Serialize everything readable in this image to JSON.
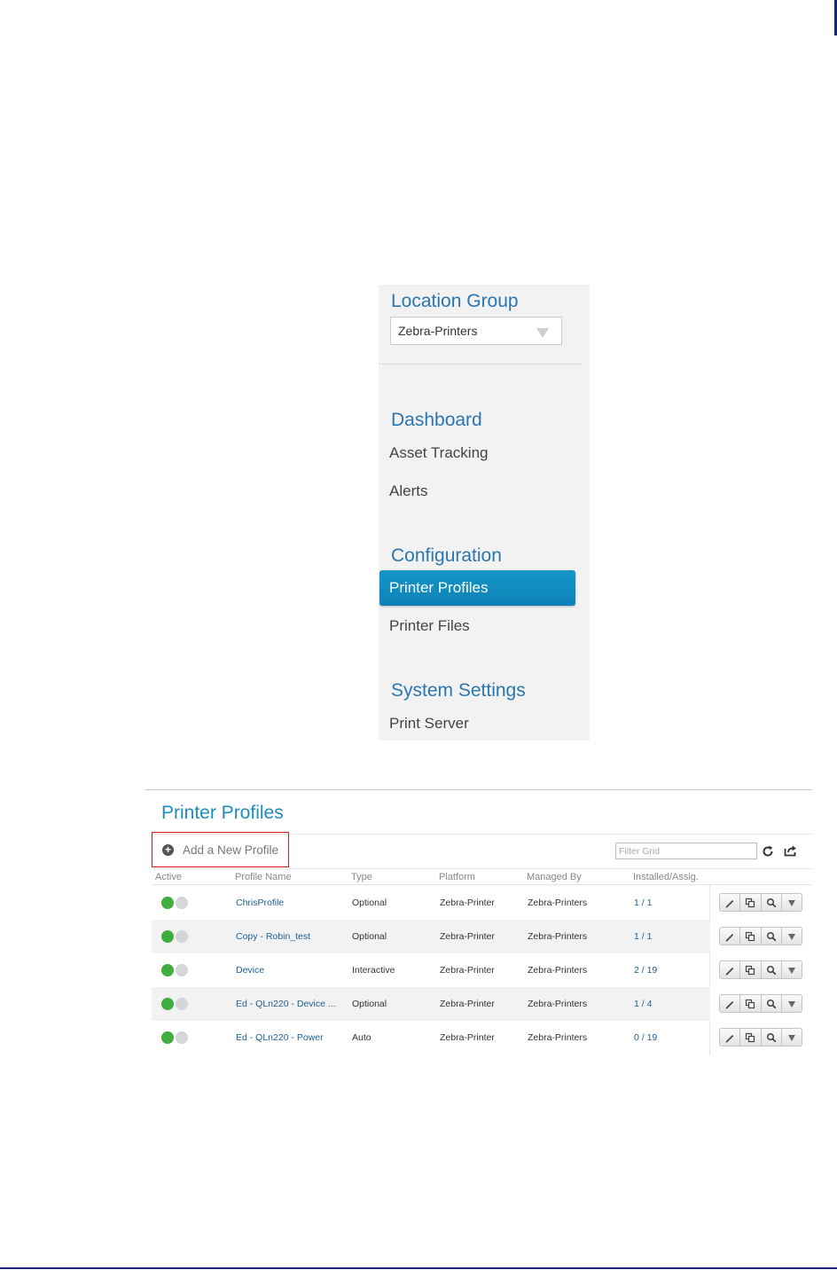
{
  "sidebar": {
    "location_group": {
      "title": "Location Group",
      "selected": "Zebra-Printers"
    },
    "sections": [
      {
        "title": "Dashboard",
        "items": [
          "Asset Tracking",
          "Alerts"
        ]
      },
      {
        "title": "Configuration",
        "items": [
          "Printer Profiles",
          "Printer Files"
        ],
        "active_item": "Printer Profiles"
      },
      {
        "title": "System Settings",
        "items": [
          "Print Server"
        ]
      }
    ]
  },
  "panel": {
    "title": "Printer Profiles",
    "add_label": "Add a New Profile",
    "filter_placeholder": "Filter Grid",
    "columns": [
      "Active",
      "Profile Name",
      "Type",
      "Platform",
      "Managed By",
      "Installed/Assig."
    ],
    "rows": [
      {
        "active": true,
        "name": "ChrisProfile",
        "type": "Optional",
        "platform": "Zebra-Printer",
        "managed_by": "Zebra-Printers",
        "installed": "1 / 1"
      },
      {
        "active": true,
        "name": "Copy - Robin_test",
        "type": "Optional",
        "platform": "Zebra-Printer",
        "managed_by": "Zebra-Printers",
        "installed": "1 / 1"
      },
      {
        "active": true,
        "name": "Device",
        "type": "Interactive",
        "platform": "Zebra-Printer",
        "managed_by": "Zebra-Printers",
        "installed": "2 / 19"
      },
      {
        "active": true,
        "name": "Ed - QLn220 - Device ...",
        "type": "Optional",
        "platform": "Zebra-Printer",
        "managed_by": "Zebra-Printers",
        "installed": "1 / 4"
      },
      {
        "active": true,
        "name": "Ed - QLn220 - Power",
        "type": "Auto",
        "platform": "Zebra-Printer",
        "managed_by": "Zebra-Printers",
        "installed": "0 / 19"
      }
    ],
    "row_actions": [
      "edit-icon",
      "copy-icon",
      "search-icon",
      "dropdown-arrow-icon"
    ]
  },
  "colors": {
    "accent": "#1e8bc3",
    "sidebar_heading": "#2b76b0",
    "active_item": "#1596c9",
    "status_on": "#3fae3f",
    "status_off": "#d6d6d6",
    "highlight_box": "#e01b1b"
  }
}
